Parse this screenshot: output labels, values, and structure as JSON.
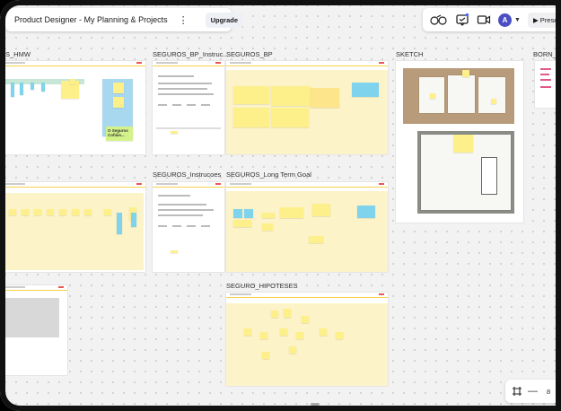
{
  "toolbar": {
    "board_title": "Product Designer - My Planning & Projects",
    "upgrade_label": "Upgrade",
    "avatar_initial": "A",
    "present_label": "Prese"
  },
  "frames": {
    "hmw": "S_HMW",
    "bp_instrucoes": "SEGUROS_BP_Instruc...",
    "bp": "SEGUROS_BP",
    "sketch": "SKETCH",
    "born": "BORN_TH",
    "instrucoes": "SEGUROS_Instrucoes",
    "long_term_goal": "SEGUROS_Long Term Goal",
    "hipoteses": "SEGURO_HIPOTESES"
  },
  "stickies": {
    "seguros_note": "O Seguros Cofiáis..."
  },
  "zoom": {
    "value": "8"
  },
  "icons": [
    "more-icon",
    "share-icon",
    "reactions-icon",
    "comment-icon",
    "video-icon",
    "chevron-down-icon",
    "play-icon",
    "fit-icon",
    "minus-icon"
  ]
}
